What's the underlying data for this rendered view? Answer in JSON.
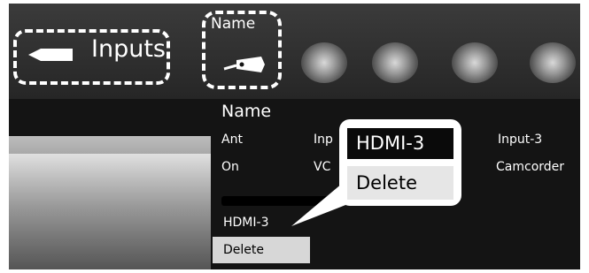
{
  "header": {
    "inputs_label": "Inputs",
    "name_label": "Name"
  },
  "list": {
    "header": "Name",
    "row1": [
      "Ant",
      "Inp",
      "Input-3"
    ],
    "row2": [
      "On",
      "VC",
      "Camcorder"
    ]
  },
  "menu": {
    "items": [
      "HDMI-3",
      "Delete"
    ]
  },
  "callout": {
    "items": [
      "HDMI-3",
      "Delete"
    ]
  },
  "icons": [
    "input-plug-icon",
    "name-tag-icon"
  ]
}
